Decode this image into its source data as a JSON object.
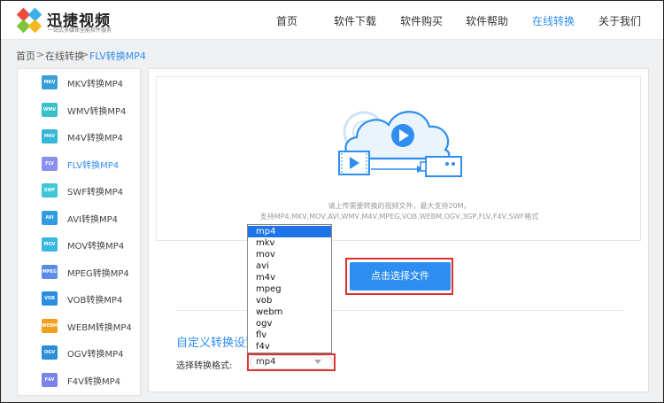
{
  "header": {
    "logo_title": "迅捷视频",
    "logo_sub": "一站式多媒体全能软件服务",
    "nav": [
      {
        "label": "首页",
        "active": false
      },
      {
        "label": "软件下载",
        "active": false
      },
      {
        "label": "软件购买",
        "active": false
      },
      {
        "label": "软件帮助",
        "active": false
      },
      {
        "label": "在线转换",
        "active": true
      },
      {
        "label": "关于我们",
        "active": false
      }
    ]
  },
  "breadcrumb": {
    "items": [
      "首页",
      "在线转换",
      "FLV转换MP4"
    ],
    "separator": ">"
  },
  "sidebar": {
    "items": [
      {
        "icon": "MKV",
        "label": "MKV转换MP4",
        "color": "#3a9fd8",
        "active": false
      },
      {
        "icon": "WMV",
        "label": "WMV转换MP4",
        "color": "#37c0c9",
        "active": false
      },
      {
        "icon": "M4V",
        "label": "M4V转换MP4",
        "color": "#36b6d6",
        "active": false
      },
      {
        "icon": "FLV",
        "label": "FLV转换MP4",
        "color": "#8a8ff0",
        "active": true
      },
      {
        "icon": "SWF",
        "label": "SWF转换MP4",
        "color": "#3fc7d8",
        "active": false
      },
      {
        "icon": "AVI",
        "label": "AVI转换MP4",
        "color": "#2f9be0",
        "active": false
      },
      {
        "icon": "MOV",
        "label": "MOV转换MP4",
        "color": "#36b8e0",
        "active": false
      },
      {
        "icon": "MPEG",
        "label": "MPEG转换MP4",
        "color": "#5b8de6",
        "active": false
      },
      {
        "icon": "VOB",
        "label": "VOB转换MP4",
        "color": "#2a8fe0",
        "active": false
      },
      {
        "icon": "WEBM",
        "label": "WEBM转换MP4",
        "color": "#f0a020",
        "active": false
      },
      {
        "icon": "OGV",
        "label": "OGV转换MP4",
        "color": "#2b8fd9",
        "active": false
      },
      {
        "icon": "F4V",
        "label": "F4V转换MP4",
        "color": "#7a84e8",
        "active": false
      }
    ]
  },
  "upload": {
    "hint_line1": "请上传需要转换的视频文件，最大支持20M，",
    "hint_line2": "支持MP4,MKV,MOV,AVI,WMV,M4V,MPEG,VOB,WEBM,OGV,3GP,FLV,F4V,SWF格式",
    "button_label": "点击选择文件"
  },
  "settings": {
    "title": "自定义转换设置",
    "format_label": "选择转换格式:",
    "format_value": "mp4",
    "options": [
      "mp4",
      "mkv",
      "mov",
      "avi",
      "m4v",
      "mpeg",
      "vob",
      "webm",
      "ogv",
      "flv",
      "f4v"
    ],
    "selected_index": 0
  },
  "colors": {
    "accent": "#2e8ef0",
    "highlight": "#e03131",
    "dropdown_selected": "#1e73e8"
  }
}
